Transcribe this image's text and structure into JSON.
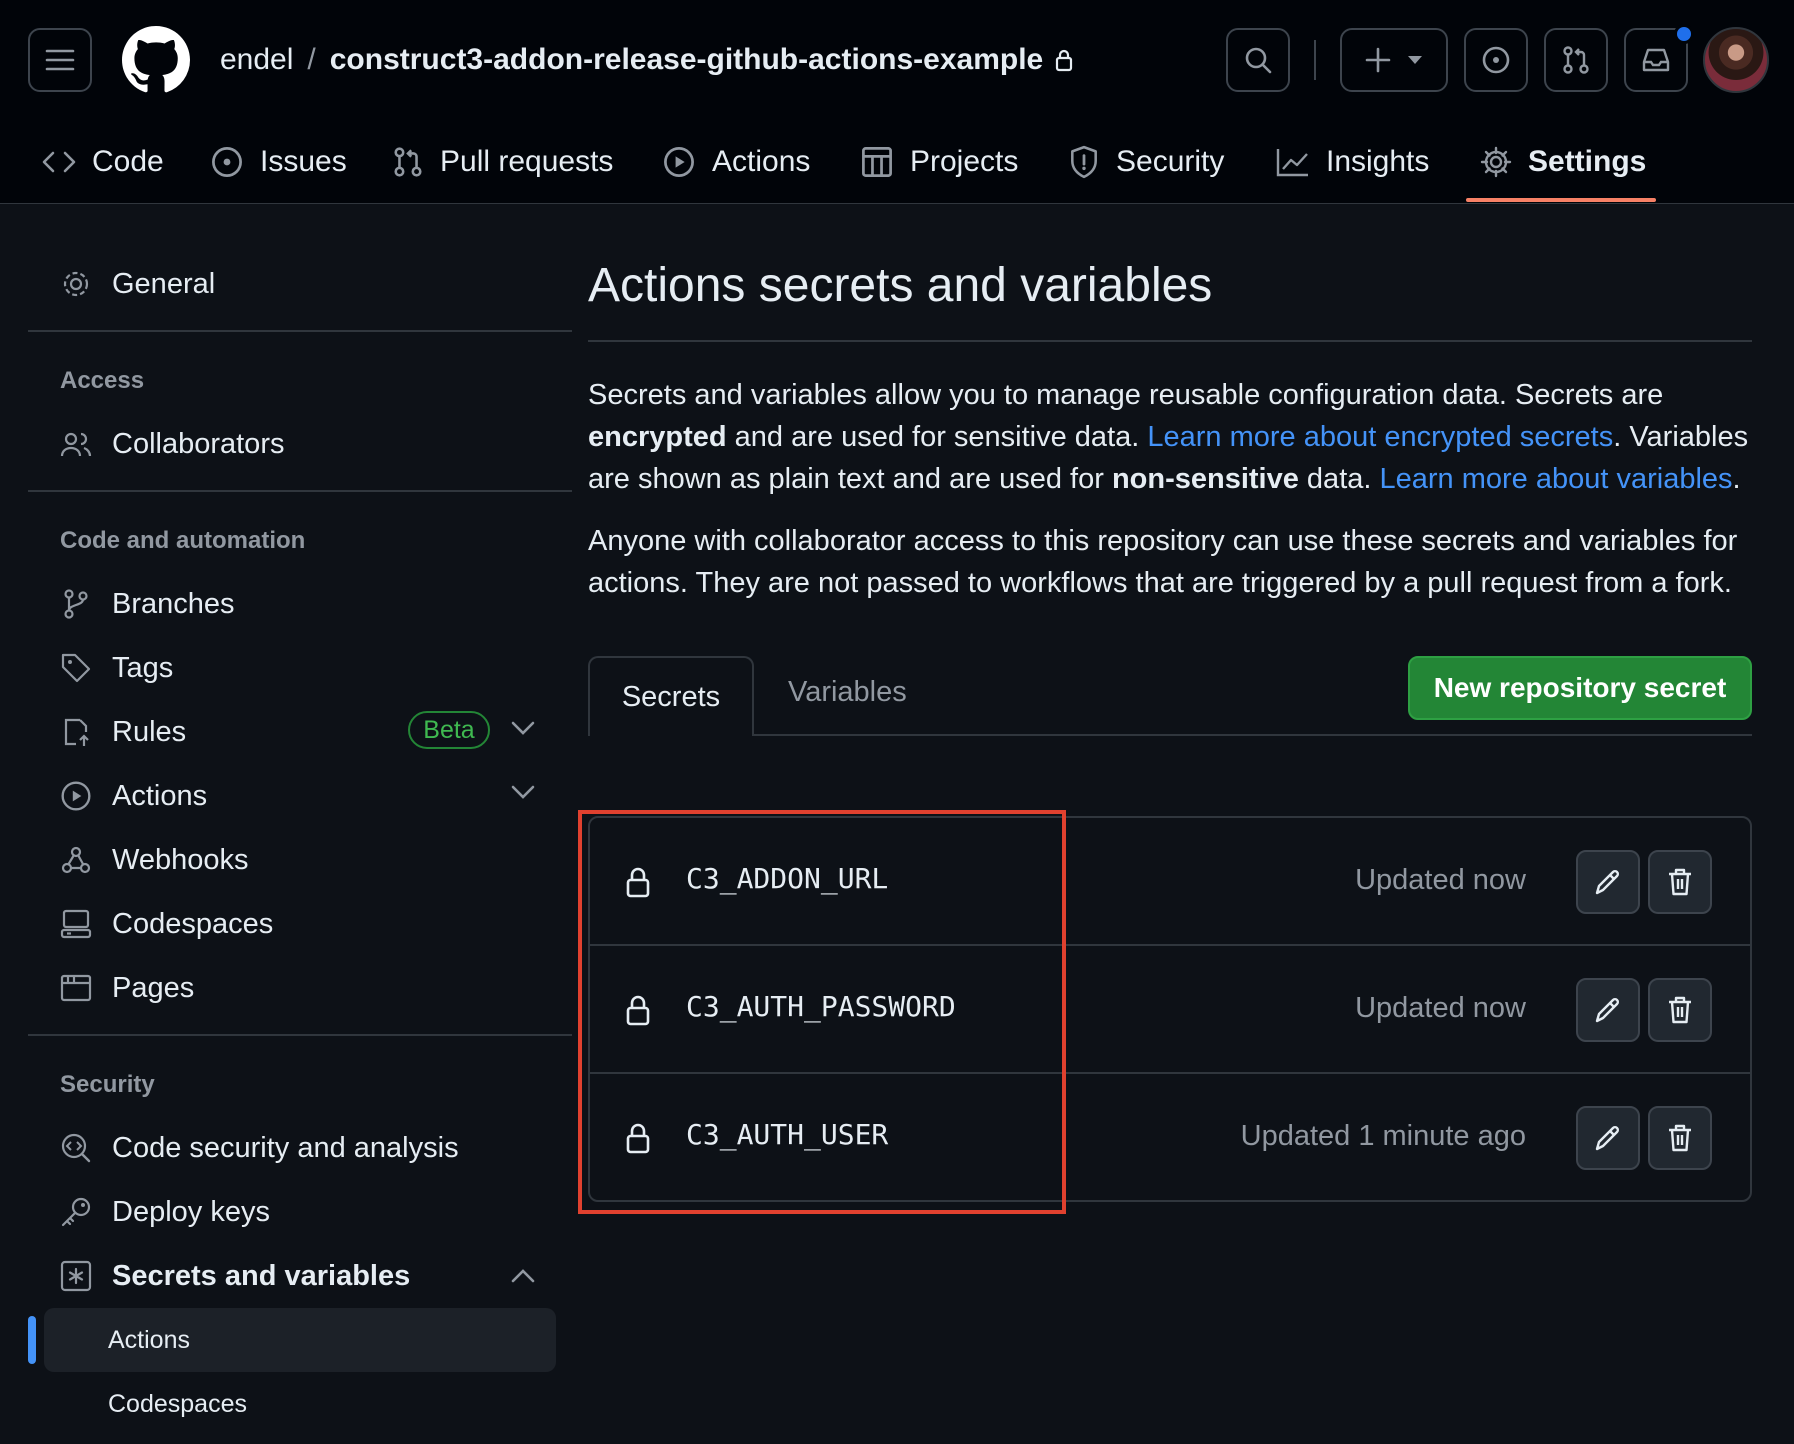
{
  "header": {
    "owner": "endel",
    "separator": "/",
    "repo": "construct3-addon-release-github-actions-example"
  },
  "tabs": [
    {
      "label": "Code",
      "icon": "code-icon"
    },
    {
      "label": "Issues",
      "icon": "issue-icon"
    },
    {
      "label": "Pull requests",
      "icon": "pull-request-icon"
    },
    {
      "label": "Actions",
      "icon": "play-icon"
    },
    {
      "label": "Projects",
      "icon": "table-icon"
    },
    {
      "label": "Security",
      "icon": "shield-icon"
    },
    {
      "label": "Insights",
      "icon": "graph-icon"
    },
    {
      "label": "Settings",
      "icon": "gear-icon",
      "active": true
    }
  ],
  "sidebar": {
    "general": "General",
    "access_heading": "Access",
    "collaborators": "Collaborators",
    "automation_heading": "Code and automation",
    "branches": "Branches",
    "tags": "Tags",
    "rules": "Rules",
    "beta": "Beta",
    "actions": "Actions",
    "webhooks": "Webhooks",
    "codespaces": "Codespaces",
    "pages": "Pages",
    "security_heading": "Security",
    "code_security": "Code security and analysis",
    "deploy_keys": "Deploy keys",
    "secrets_vars": "Secrets and variables",
    "sub_actions": "Actions",
    "sub_codespaces": "Codespaces"
  },
  "main": {
    "title": "Actions secrets and variables",
    "p1_a": "Secrets and variables allow you to manage reusable configuration data. Secrets are ",
    "p1_b": "encrypted",
    "p1_c": " and are used for sensitive data. ",
    "p1_link1": "Learn more about encrypted secrets",
    "p1_d": ". Variables are shown as plain text and are used for ",
    "p1_e": "non-sensitive",
    "p1_f": " data. ",
    "p1_link2": "Learn more about variables",
    "p1_g": ".",
    "p2": "Anyone with collaborator access to this repository can use these secrets and variables for actions. They are not passed to workflows that are triggered by a pull request from a fork.",
    "tab_secrets": "Secrets",
    "tab_variables": "Variables",
    "new_secret_button": "New repository secret",
    "secrets": [
      {
        "name": "C3_ADDON_URL",
        "updated": "Updated now"
      },
      {
        "name": "C3_AUTH_PASSWORD",
        "updated": "Updated now"
      },
      {
        "name": "C3_AUTH_USER",
        "updated": "Updated 1 minute ago"
      }
    ]
  },
  "colors": {
    "background": "#0d1117",
    "header": "#010409",
    "accent_underline": "#f78166",
    "link": "#4493f8",
    "primary_button": "#238636",
    "highlight_box": "#e0412f"
  }
}
